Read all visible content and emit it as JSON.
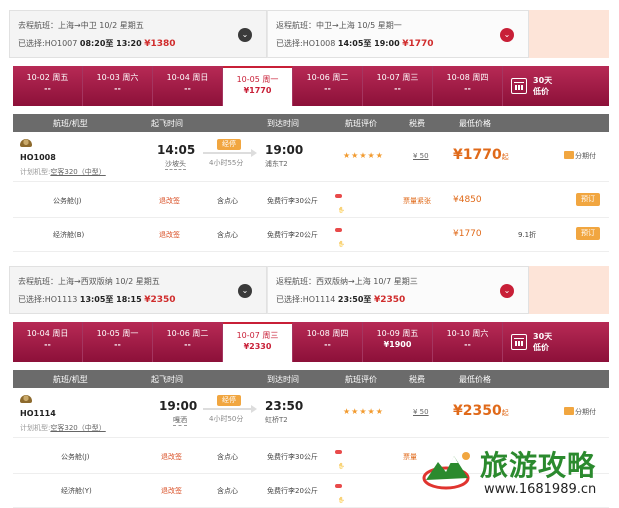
{
  "panels": [
    {
      "outbound": {
        "title": "去程航班：上海→中卫  10/2 星期五",
        "selected_prefix": "已选择:HO1007",
        "time_range": "08:20至 13:20",
        "price": "¥1380"
      },
      "inbound": {
        "title": "返程航班：中卫→上海  10/5 星期一",
        "selected_prefix": "已选择:HO1008",
        "time_range": "14:05至 19:00",
        "price": "¥1770"
      },
      "dates": [
        {
          "date": "10-02 周五",
          "price": "--"
        },
        {
          "date": "10-03 周六",
          "price": "--"
        },
        {
          "date": "10-04 周日",
          "price": "--"
        },
        {
          "date": "10-05 周一",
          "price": "¥1770",
          "selected": true
        },
        {
          "date": "10-06 周二",
          "price": "--"
        },
        {
          "date": "10-07 周三",
          "price": "--"
        },
        {
          "date": "10-08 周四",
          "price": "--"
        }
      ],
      "calendar_label_1": "30天",
      "calendar_label_2": "低价",
      "headers": [
        "航班/机型",
        "起飞时间",
        "到达时间",
        "航班评价",
        "税费",
        "最低价格"
      ],
      "flight": {
        "number": "HO1008",
        "aircraft_prefix": "计划机型:",
        "aircraft": "空客320（中型）",
        "dep_time": "14:05",
        "dep_airport": "沙坡头",
        "stop": "经停",
        "duration": "4小时55分",
        "arr_time": "19:00",
        "arr_airport": "浦东T2",
        "rating": "★★★★★",
        "tax": "¥ 50",
        "price": "¥1770",
        "price_suffix": "起",
        "installment": "分期付"
      },
      "cabins": [
        {
          "name": "公务舱(J)",
          "refund": "退改签",
          "meal": "含点心",
          "baggage": "免费行李30公斤",
          "points": "最多485积分",
          "note": "票量紧张",
          "price": "¥4850",
          "discount": "",
          "book": "预订"
        },
        {
          "name": "经济舱(B)",
          "refund": "退改签",
          "meal": "含点心",
          "baggage": "免费行李20公斤",
          "points": "最多142积分",
          "note": "",
          "price": "¥1770",
          "discount": "9.1折",
          "book": "预订"
        }
      ]
    },
    {
      "outbound": {
        "title": "去程航班：上海→西双版纳  10/2 星期五",
        "selected_prefix": "已选择:HO1113",
        "time_range": "13:05至 18:15",
        "price": "¥2350"
      },
      "inbound": {
        "title": "返程航班：西双版纳→上海  10/7 星期三",
        "selected_prefix": "已选择:HO1114",
        "time_range": "23:50至",
        "price": "¥2350"
      },
      "dates": [
        {
          "date": "10-04 周日",
          "price": "--"
        },
        {
          "date": "10-05 周一",
          "price": "--"
        },
        {
          "date": "10-06 周二",
          "price": "--"
        },
        {
          "date": "10-07 周三",
          "price": "¥2330",
          "selected": true
        },
        {
          "date": "10-08 周四",
          "price": "--"
        },
        {
          "date": "10-09 周五",
          "price": "¥1900"
        },
        {
          "date": "10-10 周六",
          "price": "--"
        }
      ],
      "calendar_label_1": "30天",
      "calendar_label_2": "低价",
      "headers": [
        "航班/机型",
        "起飞时间",
        "到达时间",
        "航班评价",
        "税费",
        "最低价格"
      ],
      "flight": {
        "number": "HO1114",
        "aircraft_prefix": "计划机型:",
        "aircraft": "空客320（中型）",
        "dep_time": "19:00",
        "dep_airport": "嘎洒",
        "stop": "经停",
        "duration": "4小时50分",
        "arr_time": "23:50",
        "arr_airport": "虹桥T2",
        "rating": "★★★★★",
        "tax": "¥ 50",
        "price": "¥2350",
        "price_suffix": "起",
        "installment": "分期付"
      },
      "cabins": [
        {
          "name": "公务舱(J)",
          "refund": "退改签",
          "meal": "含点心",
          "baggage": "免费行李30公斤",
          "points": "最多578积分",
          "note": "票量",
          "price": "",
          "discount": "",
          "book": ""
        },
        {
          "name": "经济舱(Y)",
          "refund": "退改签",
          "meal": "含点心",
          "baggage": "免费行李20公斤",
          "points": "最多235积分",
          "note": "",
          "price": "",
          "discount": "",
          "book": ""
        }
      ]
    }
  ],
  "watermark": {
    "text": "旅游攻略",
    "url": "www.1681989.cn"
  },
  "colors": {
    "brand": "#c81f37",
    "accent": "#f1a640",
    "price": "#e06a1a",
    "header": "#6b6b6b"
  }
}
